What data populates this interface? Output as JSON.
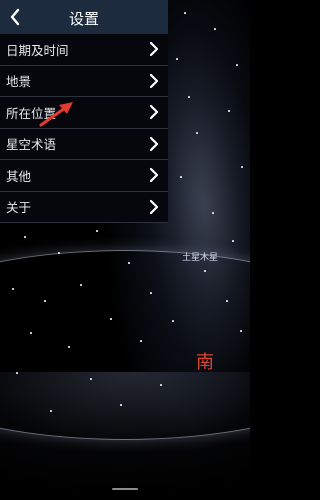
{
  "header": {
    "title": "设置",
    "back_icon": "chevron-left-icon"
  },
  "menu": {
    "items": [
      {
        "label": "日期及时间"
      },
      {
        "label": "地景"
      },
      {
        "label": "所在位置"
      },
      {
        "label": "星空术语"
      },
      {
        "label": "其他"
      },
      {
        "label": "关于"
      }
    ],
    "chevron_icon": "chevron-right-icon"
  },
  "sky": {
    "planet_label": "土星木星",
    "direction_label": "南"
  },
  "colors": {
    "header_bg": "#1d2b3e",
    "panel_bg": "#05070c",
    "divider": "#2c313c",
    "direction": "#e0452b",
    "annotation_arrow": "#e53a2e"
  }
}
